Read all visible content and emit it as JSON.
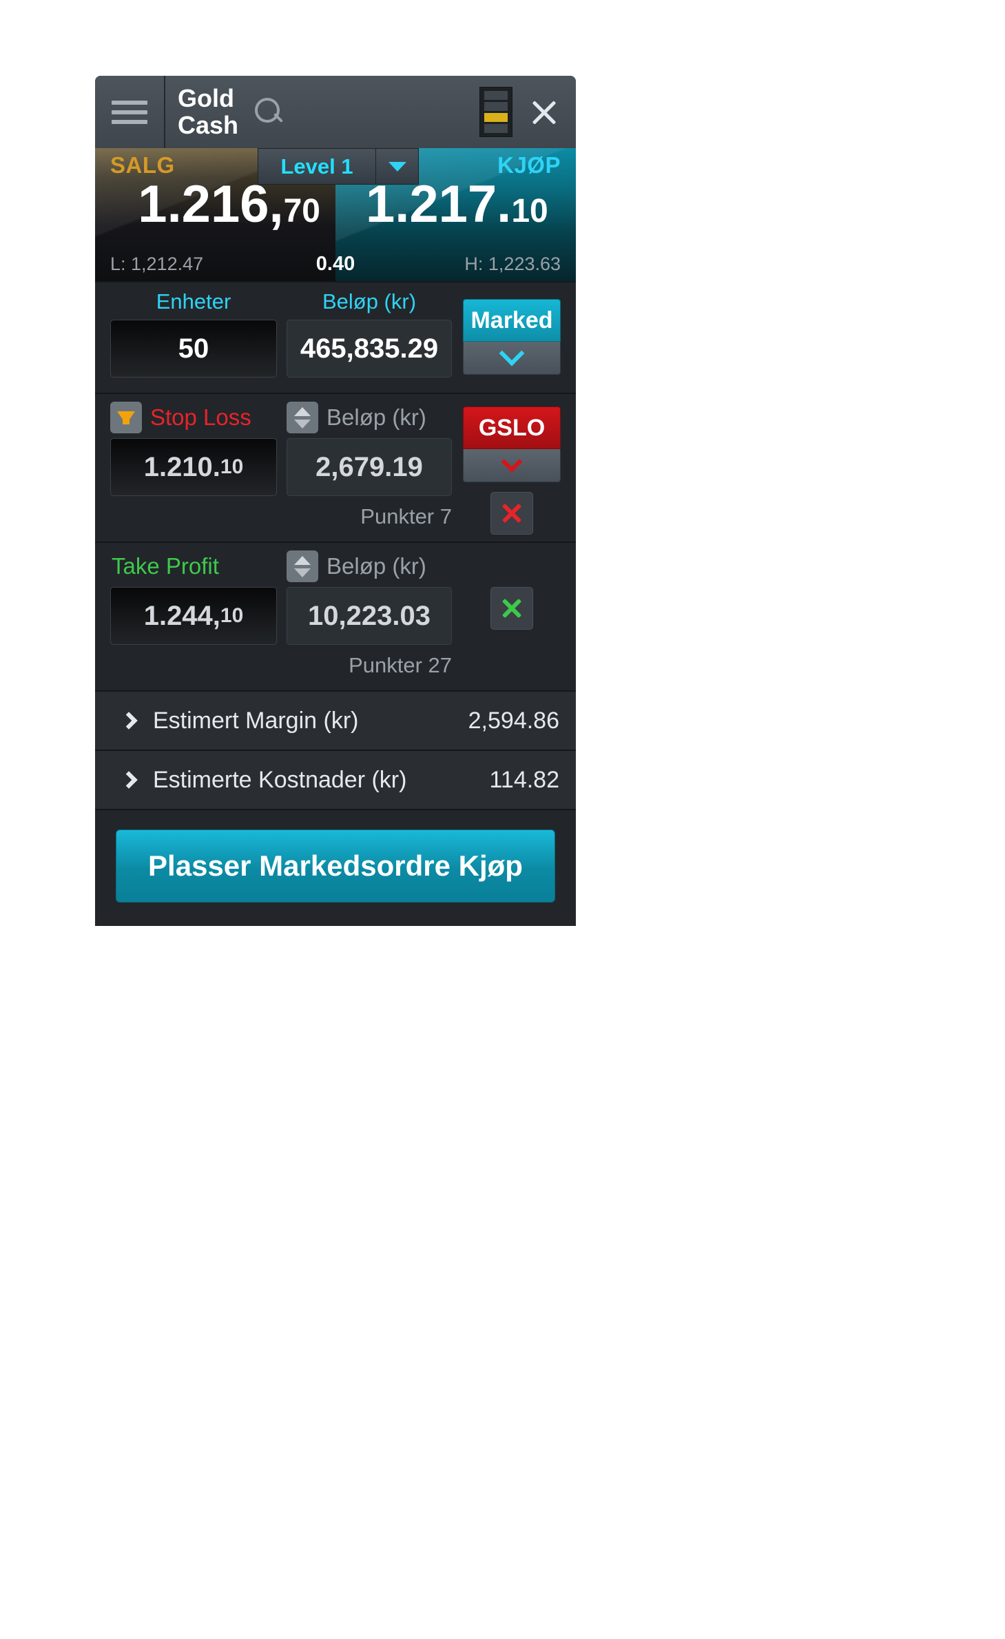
{
  "header": {
    "menu_icon": "hamburger-icon",
    "title": "Gold\nCash",
    "title_line1": "Gold",
    "title_line2": "Cash",
    "search_icon": "search-icon",
    "level_indicator_icon": "market-depth-icon",
    "close_icon": "close-icon"
  },
  "quote": {
    "sell_label": "SALG",
    "buy_label": "KJØP",
    "sell_price_main": "1.216,",
    "sell_price_frac": "70",
    "buy_price_main": "1.217.",
    "buy_price_frac": "10",
    "low": "L: 1,212.47",
    "spread": "0.40",
    "high": "H: 1,223.63",
    "level_label": "Level 1",
    "level_caret_icon": "chevron-down-icon"
  },
  "units_section": {
    "units_label": "Enheter",
    "units_value": "50",
    "amount_label": "Beløp (kr)",
    "amount_value": "465,835.29",
    "order_type_label": "Marked",
    "order_type_caret_icon": "chevron-down-icon"
  },
  "stop_loss": {
    "icon": "arrow-down-icon",
    "label": "Stop Loss",
    "price_main": "1.210.",
    "price_frac": "10",
    "stepper_icon": "stepper-up-down-icon",
    "amount_label": "Beløp (kr)",
    "amount_value": "2,679.19",
    "points": "Punkter 7",
    "gslo_label": "GSLO",
    "gslo_caret_icon": "chevron-down-icon",
    "clear_icon": "close-icon"
  },
  "take_profit": {
    "label": "Take Profit",
    "price_main": "1.244,",
    "price_frac": "10",
    "stepper_icon": "stepper-up-down-icon",
    "amount_label": "Beløp (kr)",
    "amount_value": "10,223.03",
    "points": "Punkter 27",
    "clear_icon": "close-icon"
  },
  "estimates": [
    {
      "chevron_icon": "chevron-right-icon",
      "label": "Estimert Margin (kr)",
      "value": "2,594.86"
    },
    {
      "chevron_icon": "chevron-right-icon",
      "label": "Estimerte Kostnader (kr)",
      "value": "114.82"
    }
  ],
  "footer": {
    "place_order_label": "Plasser Markedsordre Kjøp"
  },
  "colors": {
    "buy_accent": "#17b7d6",
    "sell_accent": "#d49a28",
    "cyan_label": "#2fd3f5",
    "stop_loss_red": "#e8232a",
    "take_profit_green": "#3ec94b",
    "gslo_red": "#d3161b",
    "panel_bg": "#22262a"
  }
}
